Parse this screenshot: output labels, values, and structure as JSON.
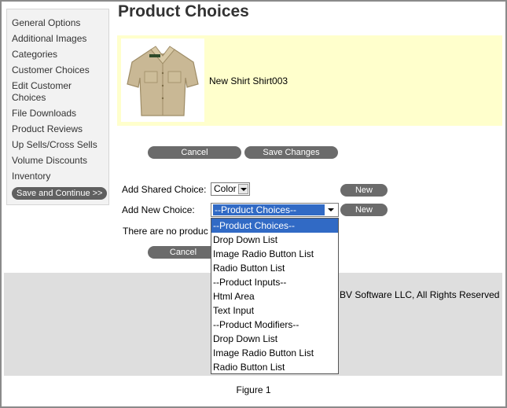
{
  "sidebar": {
    "items": [
      {
        "label": "General Options"
      },
      {
        "label": "Additional Images"
      },
      {
        "label": "Categories"
      },
      {
        "label": "Customer Choices"
      },
      {
        "label": "Edit Customer Choices"
      },
      {
        "label": "File Downloads"
      },
      {
        "label": "Product Reviews"
      },
      {
        "label": "Up Sells/Cross Sells"
      },
      {
        "label": "Volume Discounts"
      },
      {
        "label": "Inventory"
      }
    ],
    "save_continue_label": "Save and Continue >>"
  },
  "page": {
    "title": "Product Choices"
  },
  "product": {
    "name": "New Shirt Shirt003"
  },
  "actions": {
    "cancel_label": "Cancel",
    "save_changes_label": "Save Changes"
  },
  "choices": {
    "shared_label": "Add Shared Choice:",
    "shared_value": "Color",
    "new_label": "Add New Choice:",
    "new_value": "--Product Choices--",
    "new_button_label": "New",
    "no_products_text": "There are no produc",
    "options": [
      "--Product Choices--",
      "Drop Down List",
      "Image Radio Button List",
      "Radio Button List",
      "--Product Inputs--",
      "Html Area",
      "Text Input",
      "--Product Modifiers--",
      "Drop Down List",
      "Image Radio Button List",
      "Radio Button List"
    ]
  },
  "footer": {
    "copyright": "BV Software LLC, All Rights Reserved"
  },
  "caption": "Figure 1",
  "colors": {
    "highlight": "#316ac5",
    "product_bg": "#ffffcc",
    "button_bg": "#6b6b6b",
    "footer_bg": "#dedede"
  }
}
